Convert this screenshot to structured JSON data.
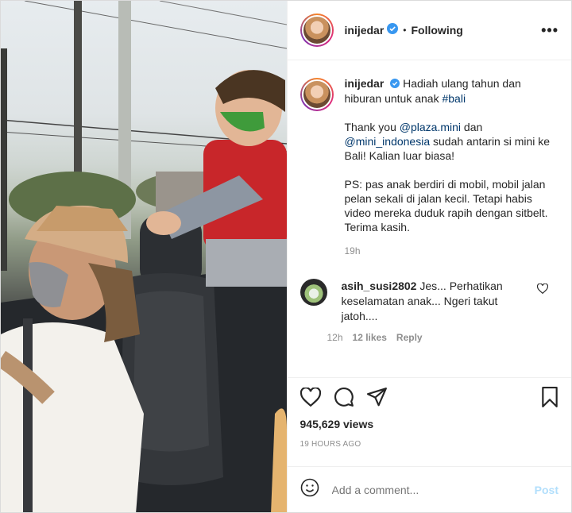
{
  "post": {
    "username": "inijedar",
    "follow_state": "Following",
    "more_label": "•••",
    "caption_line1": "Hadiah ulang tahun dan hiburan untuk anak ",
    "caption_tag": "#bali",
    "para2_prefix": "Thank you ",
    "para2_mention1": "@plaza.mini",
    "para2_mid": " dan ",
    "para2_mention2": "@mini_indonesia",
    "para2_suffix": " sudah antarin si mini ke Bali! Kalian luar biasa!",
    "para3": "PS: pas anak berdiri di mobil, mobil jalan pelan sekali di jalan kecil. Tetapi habis video mereka duduk rapih dengan sitbelt. Terima kasih.",
    "caption_time": "19h"
  },
  "reply": {
    "username": "asih_susi2802",
    "text": "Jes... Perhatikan keselamatan anak... Ngeri takut jatoh....",
    "time": "12h",
    "likes": "12 likes",
    "reply_label": "Reply"
  },
  "footer": {
    "views": "945,629 views",
    "ago": "19 HOURS AGO",
    "add_comment_placeholder": "Add a comment...",
    "post_label": "Post"
  },
  "colors": {
    "link": "#00376b",
    "muted": "#8e8e8e",
    "post_disabled": "#b2dffc"
  },
  "icons": [
    "verified-icon",
    "more-icon",
    "heart-icon",
    "comment-icon",
    "share-icon",
    "save-icon",
    "emoji-icon"
  ]
}
